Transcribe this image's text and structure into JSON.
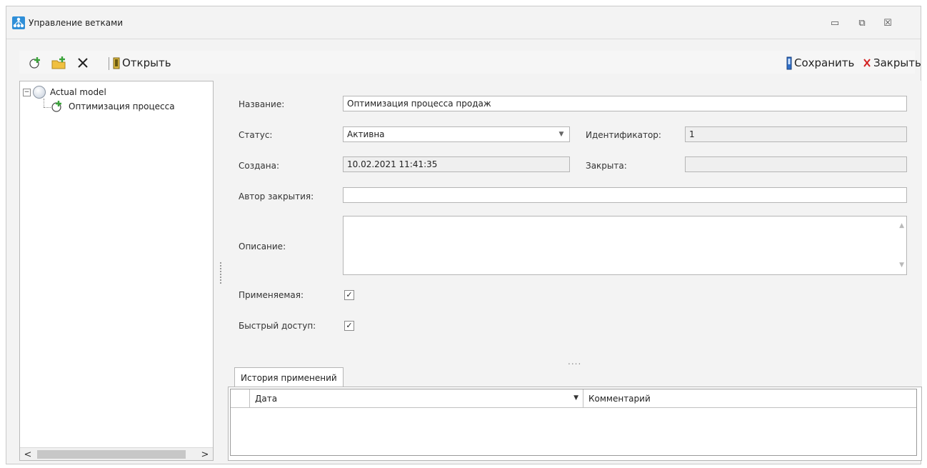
{
  "window": {
    "title": "Управление ветками",
    "controls": {
      "minimize": "▭",
      "maximize": "⧉",
      "close": "☒"
    }
  },
  "toolbar": {
    "open_label": "Открыть",
    "save_label": "Сохранить",
    "close_label": "Закрыть",
    "icons": [
      "add-branch-icon",
      "add-folder-icon",
      "delete-icon",
      "open-icon",
      "save-icon",
      "close-x-icon"
    ]
  },
  "tree": {
    "root_label": "Actual model",
    "child_label": "Оптимизация процесса",
    "expander": "−"
  },
  "form": {
    "name_label": "Название:",
    "name_value": "Оптимизация процесса продаж",
    "status_label": "Статус:",
    "status_value": "Активна",
    "id_label": "Идентификатор:",
    "id_value": "1",
    "created_label": "Создана:",
    "created_value": "10.02.2021 11:41:35",
    "closed_label": "Закрыта:",
    "closed_value": "",
    "close_author_label": "Автор закрытия:",
    "close_author_value": "",
    "description_label": "Описание:",
    "description_value": "",
    "applied_label": "Применяемая:",
    "applied_checked": true,
    "quick_access_label": "Быстрый доступ:",
    "quick_access_checked": true,
    "check_mark": "✓",
    "splitter_dots": "....",
    "scroll_left": "<",
    "scroll_right": ">"
  },
  "history": {
    "tab_label": "История применений",
    "columns": [
      "Дата",
      "Комментарий"
    ],
    "rows": []
  },
  "colors": {
    "accent": "#2f8fd8",
    "close_red": "#d42020",
    "add_green": "#3aa33a"
  }
}
